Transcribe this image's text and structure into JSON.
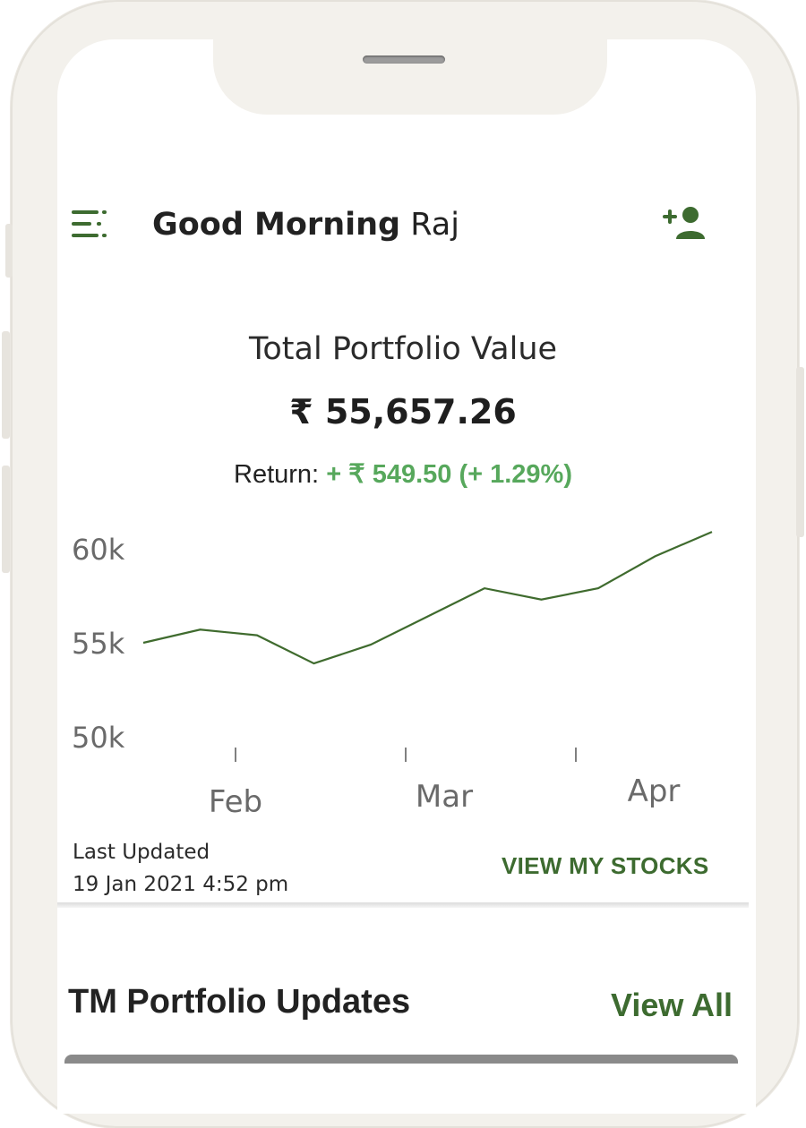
{
  "header": {
    "greeting_bold": "Good Morning",
    "greeting_name": "Raj",
    "menu_icon": "menu-icon",
    "add_user_icon": "add-user-icon"
  },
  "portfolio": {
    "label": "Total Portfolio Value",
    "value": "₹ 55,657.26",
    "return_label": "Return:",
    "return_value": "+ ₹ 549.50 (+ 1.29%)"
  },
  "chart_data": {
    "type": "line",
    "title": "",
    "y_ticks": [
      "60k",
      "55k",
      "50k"
    ],
    "x_ticks": [
      "Feb",
      "Mar",
      "Apr"
    ],
    "ylim": [
      50000,
      60000
    ],
    "grid": false,
    "series": [
      {
        "values": [
          55000,
          55700,
          55400,
          53900,
          54900,
          56400,
          57900,
          57300,
          57900,
          59600,
          60900
        ]
      }
    ]
  },
  "footer": {
    "last_updated_label": "Last Updated",
    "last_updated_time": "19 Jan 2021 4:52 pm",
    "view_stocks_label": "VIEW MY STOCKS"
  },
  "updates": {
    "title": "TM Portfolio Updates",
    "view_all_label": "View All"
  },
  "colors": {
    "brand_green": "#3d6b30",
    "return_green": "#57a85c",
    "line": "#3f6b2e"
  }
}
